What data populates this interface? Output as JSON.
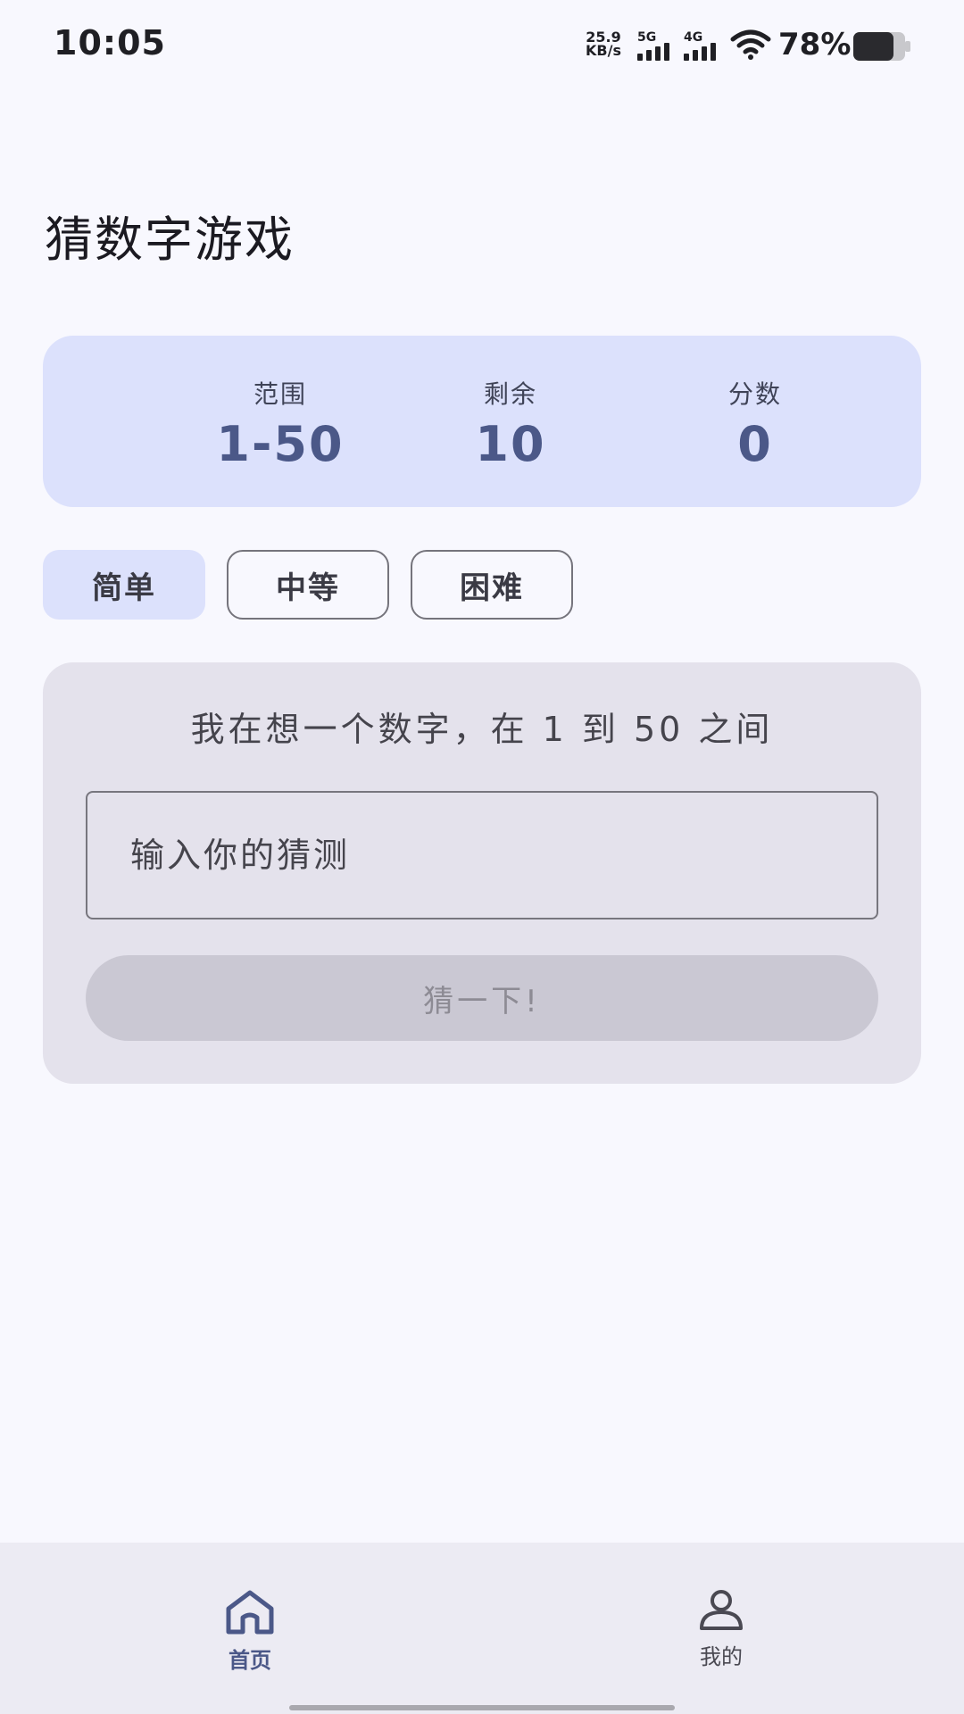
{
  "status_bar": {
    "time": "10:05",
    "net_speed_value": "25.9",
    "net_speed_unit": "KB/s",
    "signal_1_label": "5G",
    "signal_2_label": "4G",
    "battery_percent": "78%",
    "battery_level": 0.78
  },
  "title": "猜数字游戏",
  "stats": {
    "range_label": "范围",
    "range_value": "1-50",
    "remaining_label": "剩余",
    "remaining_value": "10",
    "score_label": "分数",
    "score_value": "0"
  },
  "difficulty": {
    "easy": "简单",
    "medium": "中等",
    "hard": "困难",
    "selected": "简单"
  },
  "game": {
    "prompt": "我在想一个数字，在 1 到 50 之间",
    "input_placeholder": "输入你的猜测",
    "input_value": "",
    "button_label": "猜一下!"
  },
  "nav": {
    "home_label": "首页",
    "mine_label": "我的",
    "active": "首页"
  },
  "colors": {
    "accent": "#4b5888",
    "stats_bg": "#dce1fc",
    "card_bg": "#e4e2ec",
    "button_disabled": "#cac8d3"
  }
}
